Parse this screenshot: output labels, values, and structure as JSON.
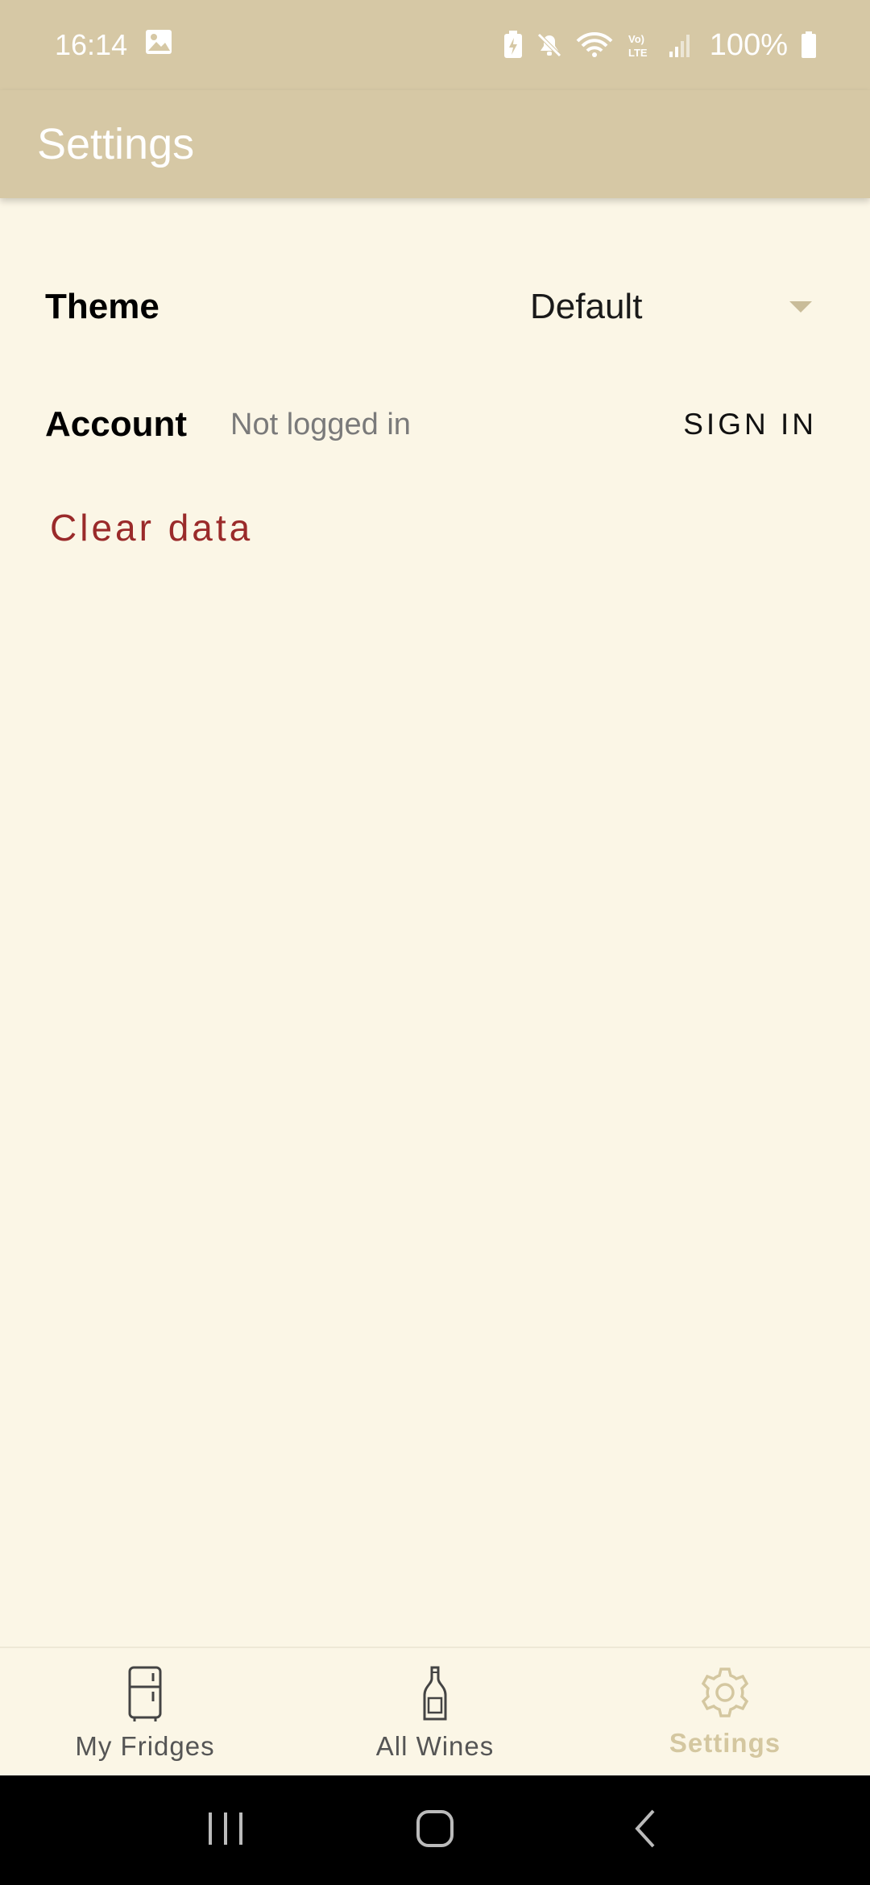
{
  "status_bar": {
    "time": "16:14",
    "battery": "100%",
    "icons": [
      "image-icon",
      "battery-saver-icon",
      "mute-icon",
      "wifi-icon",
      "volte-icon",
      "signal-icon",
      "battery-icon"
    ]
  },
  "app_bar": {
    "title": "Settings"
  },
  "settings": {
    "theme_label": "Theme",
    "theme_value": "Default",
    "account_label": "Account",
    "account_status": "Not logged in",
    "sign_in_label": "SIGN IN",
    "clear_data_label": "Clear data"
  },
  "bottom_nav": {
    "items": [
      {
        "label": "My Fridges",
        "icon": "fridge-icon"
      },
      {
        "label": "All Wines",
        "icon": "wine-bottle-icon"
      },
      {
        "label": "Settings",
        "icon": "gear-icon"
      }
    ],
    "active_index": 2
  },
  "colors": {
    "header": "#D6C8A5",
    "background": "#FBF6E6",
    "destructive": "#9A2A2A",
    "active_nav": "#D4C7A0"
  }
}
